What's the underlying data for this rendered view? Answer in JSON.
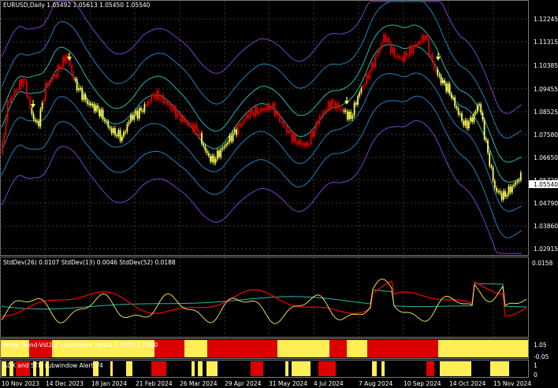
{
  "main": {
    "title": "EURUSD,Daily  1.05492 1.05613 1.05450 1.05540",
    "price_levels": [
      "1.12245",
      "1.11315",
      "1.10385",
      "1.09455",
      "1.08525",
      "1.07580",
      "1.06650",
      "1.05720",
      "1.04790",
      "1.03860",
      "1.02915"
    ],
    "current_price": "1.05540",
    "colors": {
      "bull": "#ffff55",
      "bear": "#dd0000",
      "band_outer": "#7b3fc8",
      "band_inner": "#1f7fbf",
      "band_mid": "#28b8b0",
      "grid": "#3a3a3a"
    }
  },
  "stddev": {
    "title": "StdDev(26) 0.0107  StdDev(13) 0.0046  StdDev(52) 0.0188",
    "top_level": "0.0158",
    "colors": {
      "sd26": "#ee0000",
      "sd13": "#ffee55",
      "sd52": "#28b8b0"
    }
  },
  "megatrend": {
    "title": "Mega Trend-Vst2.0 subwindow zatala 0.0000 1.0000",
    "levels": [
      "1.05",
      "-0.05"
    ]
  },
  "adx": {
    "title": "ADX and STD subwindow Alert V4",
    "levels": [
      "1",
      "0"
    ]
  },
  "x_axis": {
    "labels": [
      "10 Nov 2023",
      "14 Dec 2023",
      "18 Jan 2024",
      "21 Feb 2024",
      "26 Mar 2024",
      "29 Apr 2024",
      "31 May 2024",
      "4 Jul 2024",
      "7 Aug 2024",
      "10 Sep 2024",
      "14 Oct 2024",
      "15 Nov 2024"
    ]
  }
}
